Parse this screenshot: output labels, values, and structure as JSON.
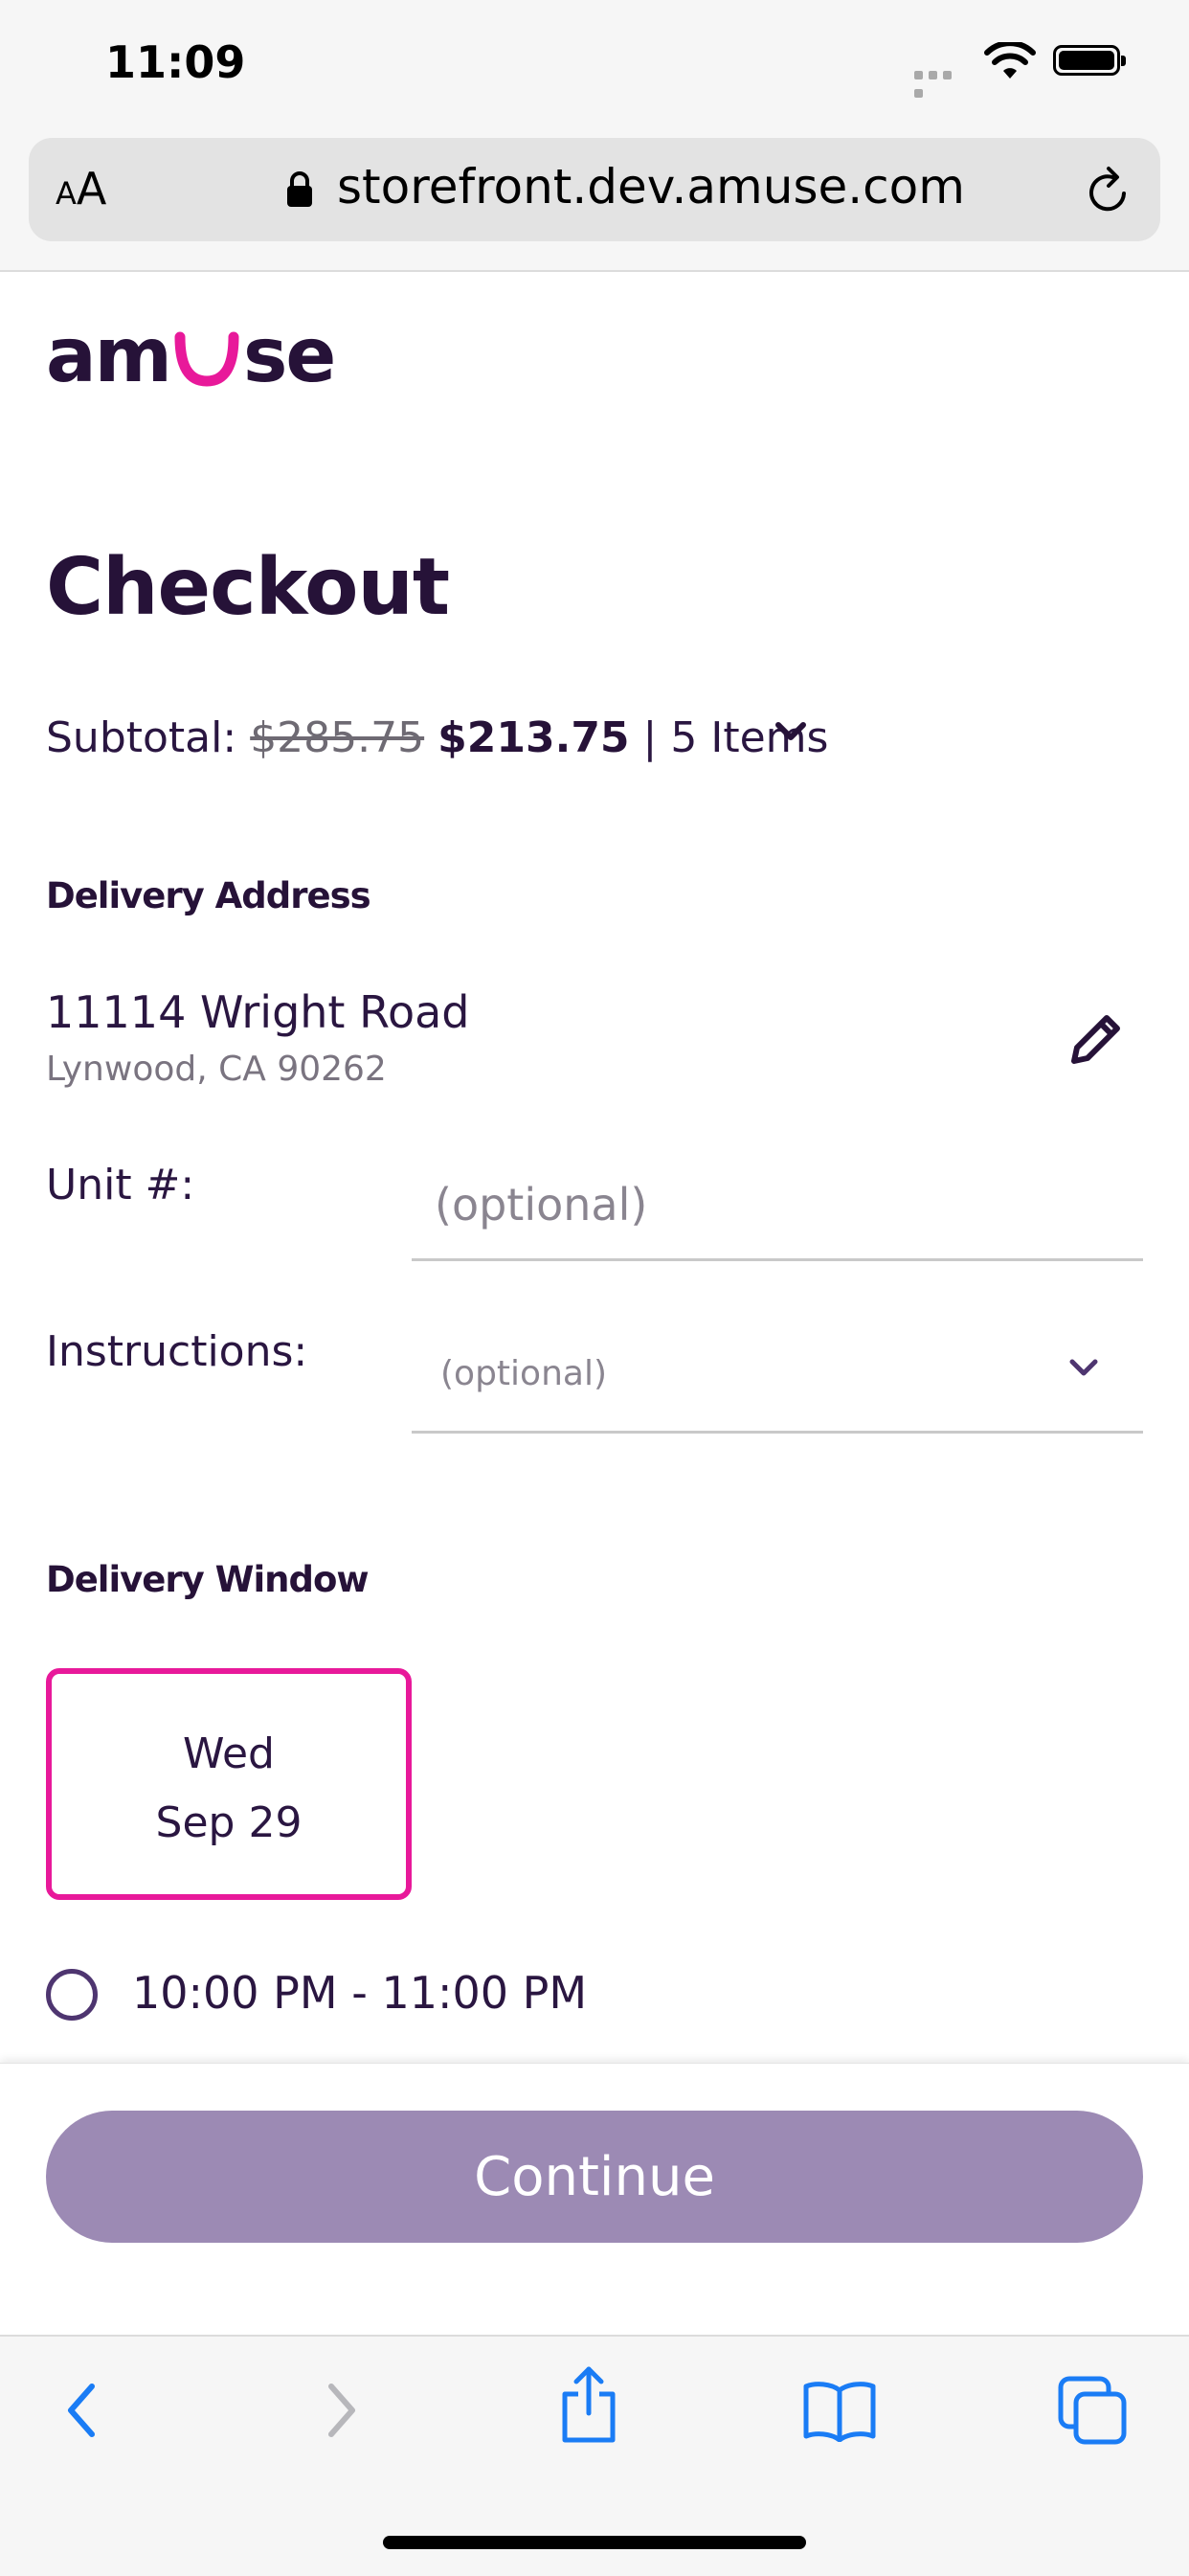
{
  "status_bar": {
    "time": "11:09"
  },
  "browser": {
    "text_size_small": "A",
    "text_size_large": "A",
    "url": "storefront.dev.amuse.com"
  },
  "brand": {
    "name": "amuse",
    "text_color": "#261238",
    "accent_color": "#e8199a"
  },
  "page": {
    "title": "Checkout"
  },
  "subtotal": {
    "label": "Subtotal:",
    "original_price": "$285.75",
    "discounted_price": "$213.75",
    "separator": "|",
    "items": "5 Items"
  },
  "delivery_address": {
    "section_label": "Delivery Address",
    "street": "11114 Wright Road",
    "city_line": "Lynwood, CA 90262"
  },
  "unit": {
    "label": "Unit #:",
    "placeholder": "(optional)",
    "value": ""
  },
  "instructions": {
    "label": "Instructions:",
    "placeholder": "(optional)"
  },
  "delivery_window": {
    "section_label": "Delivery Window",
    "selected_date": {
      "day_of_week": "Wed",
      "date": "Sep 29"
    },
    "time_slots": [
      "10:00 PM - 11:00 PM"
    ]
  },
  "footer": {
    "continue_label": "Continue",
    "button_color": "#9c8ab4"
  },
  "toolbar": {
    "icons": [
      "back-icon",
      "forward-icon",
      "share-icon",
      "bookmarks-icon",
      "tabs-icon"
    ],
    "icon_color": "#1a7cf5"
  }
}
